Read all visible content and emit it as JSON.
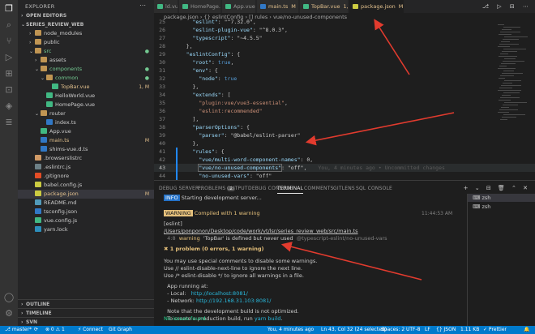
{
  "sidebar": {
    "title": "EXPLORER",
    "open_editors": "OPEN EDITORS",
    "project": "SERIES_REVIEW_WEB",
    "items": [
      {
        "label": "node_modules",
        "indent": 2,
        "chev": "›",
        "icon": "folder"
      },
      {
        "label": "public",
        "indent": 2,
        "chev": "›",
        "icon": "folder"
      },
      {
        "label": "src",
        "indent": 2,
        "chev": "⌄",
        "icon": "folder",
        "badge": "●",
        "badge_color": "#73c991",
        "color": "#73c991"
      },
      {
        "label": "assets",
        "indent": 3,
        "chev": "›",
        "icon": "folder"
      },
      {
        "label": "components",
        "indent": 3,
        "chev": "⌄",
        "icon": "folder",
        "badge": "●",
        "badge_color": "#73c991",
        "color": "#73c991"
      },
      {
        "label": "common",
        "indent": 4,
        "chev": "⌄",
        "icon": "folder",
        "badge": "●",
        "badge_color": "#73c991",
        "color": "#73c991"
      },
      {
        "label": "TopBar.vue",
        "indent": 5,
        "chev": "",
        "icon": "vue",
        "badge": "1, M",
        "badge_color": "#e2c08d",
        "color": "#e2c08d"
      },
      {
        "label": "HelloWorld.vue",
        "indent": 4,
        "chev": "",
        "icon": "vue"
      },
      {
        "label": "HomePage.vue",
        "indent": 4,
        "chev": "",
        "icon": "vue"
      },
      {
        "label": "router",
        "indent": 3,
        "chev": "⌄",
        "icon": "folder"
      },
      {
        "label": "index.ts",
        "indent": 4,
        "chev": "",
        "icon": "ts"
      },
      {
        "label": "App.vue",
        "indent": 3,
        "chev": "",
        "icon": "vue"
      },
      {
        "label": "main.ts",
        "indent": 3,
        "chev": "",
        "icon": "ts",
        "badge": "M",
        "badge_color": "#e2c08d",
        "color": "#e2c08d"
      },
      {
        "label": "shims-vue.d.ts",
        "indent": 3,
        "chev": "",
        "icon": "ts"
      },
      {
        "label": ".browserslistrc",
        "indent": 2,
        "chev": "",
        "icon": "dot"
      },
      {
        "label": ".eslintrc.js",
        "indent": 2,
        "chev": "",
        "icon": "gray"
      },
      {
        "label": ".gitignore",
        "indent": 2,
        "chev": "",
        "icon": "git"
      },
      {
        "label": "babel.config.js",
        "indent": 2,
        "chev": "",
        "icon": "js"
      },
      {
        "label": "package.json",
        "indent": 2,
        "chev": "",
        "icon": "json",
        "badge": "M",
        "badge_color": "#e2c08d",
        "color": "#e2c08d",
        "selected": true
      },
      {
        "label": "README.md",
        "indent": 2,
        "chev": "",
        "icon": "md"
      },
      {
        "label": "tsconfig.json",
        "indent": 2,
        "chev": "",
        "icon": "ts"
      },
      {
        "label": "vue.config.js",
        "indent": 2,
        "chev": "",
        "icon": "vue"
      },
      {
        "label": "yarn.lock",
        "indent": 2,
        "chev": "",
        "icon": "yarn"
      }
    ],
    "outline": "OUTLINE",
    "timeline": "TIMELINE",
    "svn": "SVN"
  },
  "tabs": [
    {
      "label": "ld.vue",
      "icon": "vue"
    },
    {
      "label": "HomePage.vue",
      "icon": "vue"
    },
    {
      "label": "App.vue",
      "icon": "vue"
    },
    {
      "label": "main.ts",
      "icon": "ts",
      "badge": "M"
    },
    {
      "label": "TopBar.vue",
      "icon": "vue",
      "badge": "1, M"
    },
    {
      "label": "package.json",
      "icon": "json",
      "badge": "M",
      "active": true
    }
  ],
  "tab_actions": "⎇ ▷ ⊟ ⋯",
  "breadcrumb": "package.json › {} eslintConfig › [] rules › vue/no-unused-components",
  "code": [
    {
      "ln": "25",
      "text": "      \"eslint\": \"^7.32.0\","
    },
    {
      "ln": "26",
      "text": "      \"eslint-plugin-vue\": \"^8.0.3\","
    },
    {
      "ln": "27",
      "text": "      \"typescript\": \"~4.5.5\""
    },
    {
      "ln": "28",
      "text": "    },"
    },
    {
      "ln": "29",
      "text": "    \"eslintConfig\": {"
    },
    {
      "ln": "30",
      "text": "      \"root\": true,"
    },
    {
      "ln": "31",
      "text": "      \"env\": {"
    },
    {
      "ln": "32",
      "text": "        \"node\": true"
    },
    {
      "ln": "33",
      "text": "      },"
    },
    {
      "ln": "34",
      "text": "      \"extends\": ["
    },
    {
      "ln": "35",
      "text": "        \"plugin:vue/vue3-essential\","
    },
    {
      "ln": "36",
      "text": "        \"eslint:recommended\""
    },
    {
      "ln": "37",
      "text": "      ],"
    },
    {
      "ln": "38",
      "text": "      \"parserOptions\": {"
    },
    {
      "ln": "39",
      "text": "        \"parser\": \"@babel/eslint-parser\""
    },
    {
      "ln": "40",
      "text": "      },"
    },
    {
      "ln": "41",
      "text": "      \"rules\": {"
    },
    {
      "ln": "42",
      "text": "        \"vue/multi-word-component-names\": 0,"
    },
    {
      "ln": "43",
      "text": "        \"vue/no-unused-components\": \"off\","
    },
    {
      "ln": "44",
      "text": "        \"no-unused-vars\": \"off\""
    },
    {
      "ln": "45",
      "text": "      }"
    },
    {
      "ln": "46",
      "text": "    }"
    },
    {
      "ln": "47",
      "text": "  }"
    }
  ],
  "blame": "You, 4 minutes ago • Uncommitted changes",
  "panel": {
    "tabs": [
      {
        "label": "DEBUG SERVER..."
      },
      {
        "label": "PROBLEMS",
        "count": "2"
      },
      {
        "label": "OUTPUT"
      },
      {
        "label": "DEBUG CONSOLE"
      },
      {
        "label": "TERMINAL",
        "active": true
      },
      {
        "label": "COMMENTS"
      },
      {
        "label": "GITLENS"
      },
      {
        "label": "SQL CONSOLE"
      }
    ],
    "tools": "+ ⌄ ⊟ 🗑 ⌃ ✕",
    "terminal_list": [
      "zsh",
      "zsh"
    ],
    "lines": {
      "info_badge": "INFO",
      "info_text": " Starting development server...",
      "warn_badge": "WARNING",
      "warn_text": " Compiled with 1 warning",
      "timestamp": "11:44:53 AM",
      "eslint": "[eslint]",
      "path": "/Users/ponponon/Desktop/code/work/vt/lsr/series_review_web/src/main.ts",
      "loc": "  4:8",
      "warning_word": "  warning",
      "warning_msg": "  'TopBar' is defined but never used",
      "warning_rule": "  @typescript-eslint/no-unused-vars",
      "problem_summary": "✖ 1 problem (0 errors, 1 warning)",
      "hint1": "You may use special comments to disable some warnings.",
      "hint2": "Use // eslint-disable-next-line to ignore the next line.",
      "hint3": "Use /* eslint-disable */ to ignore all warnings in a file.",
      "running": "  App running at:",
      "local_label": "  - Local:   ",
      "local_url": "http://localhost:8081/",
      "network_label": "  - Network: ",
      "network_url": "http://192.168.31.103:8081/",
      "note1": "  Note that the development build is not optimized.",
      "note2": "  To create a production build, run ",
      "note2_cmd": "yarn build",
      "note2_end": ".",
      "no_issues": "No issues found."
    }
  },
  "status": {
    "branch": "⎇ master*",
    "sync": "⟳",
    "problems": "⊗ 0 ⚠ 1",
    "connect": "⚡ Connect",
    "git_graph": "Git Graph",
    "blame": "You, 4 minutes ago",
    "cursor": "Ln 43, Col 32 (24 selected)",
    "spaces": "Spaces: 2",
    "encoding": "UTF-8",
    "eol": "LF",
    "lang": "{} JSON",
    "size": "1.11 KB",
    "prettier": "✓ Prettier",
    "bell": "🔔"
  }
}
